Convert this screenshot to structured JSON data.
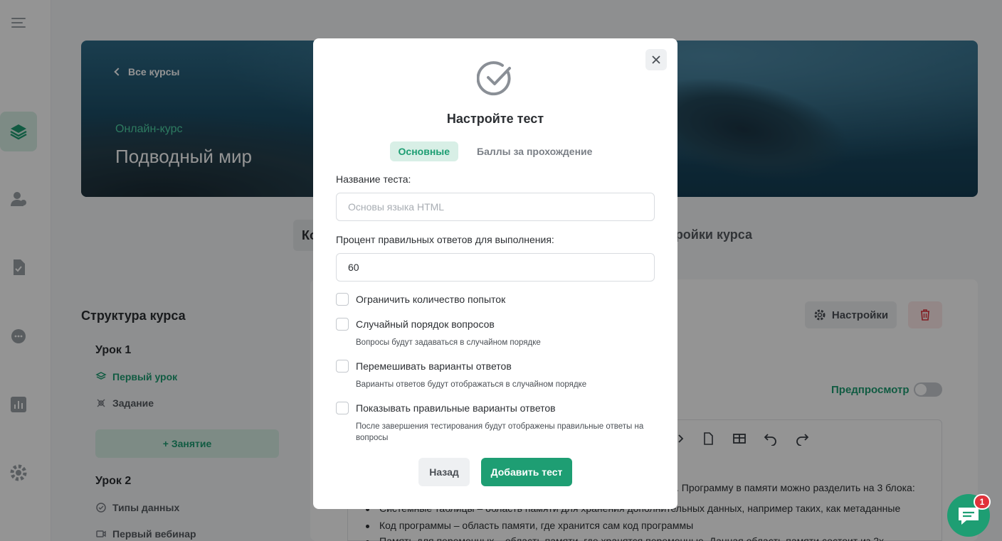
{
  "colors": {
    "accent": "#1e9e73",
    "accent_light": "#d8efe6",
    "danger": "#e0323b"
  },
  "sidebar": {
    "icons": [
      "menu-icon",
      "layers-icon",
      "users-icon",
      "file-check-icon",
      "chat-icon",
      "chart-icon",
      "gear-icon"
    ]
  },
  "hero": {
    "back_label": "Все курсы",
    "subtitle": "Онлайн-курс",
    "title": "Подводный мир"
  },
  "course_tabs": {
    "active_partial": "Ко",
    "settings_partial": "тройки курса"
  },
  "structure": {
    "title": "Структура курса",
    "lesson1": {
      "title": "Урок 1",
      "items": [
        "Первый урок",
        "Задание"
      ]
    },
    "add_class": "+ Занятие",
    "lesson2": {
      "title": "Урок 2",
      "items": [
        "Типы данных",
        "Первый вебинар"
      ]
    }
  },
  "content": {
    "settings_button": "Настройки",
    "preview_label": "Предпросмотр",
    "line1": ". Программу в памяти можно разделить на 3 блока:",
    "bullet1": "Системные таблицы – область памяти для хранения дополнительных данных, например таких, как метаданные",
    "bullet2": "Код программы – область памяти, где хранится сам код программы",
    "bullet3": "Память для переменных – область памяти, где хранятся переменные. Данная область памяти состоит из 2х"
  },
  "chat": {
    "badge": "1"
  },
  "modal": {
    "title": "Настройте тест",
    "tabs": [
      "Основные",
      "Баллы за прохождение"
    ],
    "name_label": "Название теста:",
    "name_placeholder": "Основы языка HTML",
    "percent_label": "Процент правильных ответов для выполнения:",
    "percent_value": "60",
    "options": [
      {
        "label": "Ограничить количество попыток",
        "hint": ""
      },
      {
        "label": "Случайный порядок вопросов",
        "hint": "Вопросы будут задаваться в случайном порядке"
      },
      {
        "label": "Перемешивать варианты ответов",
        "hint": "Варианты ответов будут отображаться в случайном порядке"
      },
      {
        "label": "Показывать правильные варианты ответов",
        "hint": "После завершения тестирования будут отображены правильные ответы на вопросы"
      }
    ],
    "back_button": "Назад",
    "submit_button": "Добавить тест"
  }
}
